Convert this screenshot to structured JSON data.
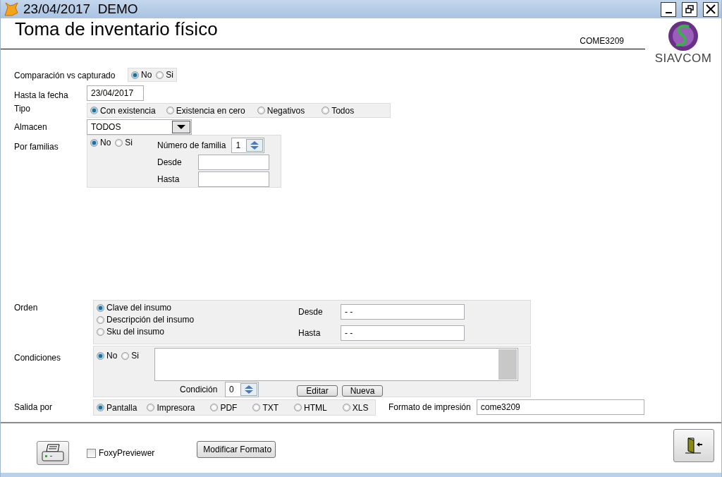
{
  "window": {
    "title": "23/04/2017  DEMO"
  },
  "header": {
    "title": "Toma de inventario físico",
    "code": "COME3209",
    "logo_text": "SIAVCOM"
  },
  "comparacion": {
    "label": "Comparación vs capturado",
    "options": [
      {
        "label": "No",
        "selected": true
      },
      {
        "label": "Si",
        "selected": false
      }
    ]
  },
  "hasta_fecha": {
    "label": "Hasta la fecha",
    "value": "23/04/2017"
  },
  "tipo": {
    "label": "Tipo",
    "options": [
      {
        "label": "Con existencia",
        "selected": true
      },
      {
        "label": "Existencia en cero",
        "selected": false
      },
      {
        "label": "Negativos",
        "selected": false
      },
      {
        "label": "Todos",
        "selected": false
      }
    ]
  },
  "almacen": {
    "label": "Almacen",
    "value": "TODOS"
  },
  "familias": {
    "label": "Por familias",
    "options": [
      {
        "label": "No",
        "selected": true
      },
      {
        "label": "Si",
        "selected": false
      }
    ],
    "numero_label": "Número de familia",
    "numero_value": "1",
    "desde_label": "Desde",
    "hasta_label": "Hasta"
  },
  "orden": {
    "label": "Orden",
    "options": [
      {
        "label": "Clave del insumo",
        "selected": true
      },
      {
        "label": "Descripción del insumo",
        "selected": false
      },
      {
        "label": "Sku del insumo",
        "selected": false
      }
    ],
    "desde_label": "Desde",
    "desde_value": "- -",
    "hasta_label": "Hasta",
    "hasta_value": "- -"
  },
  "condiciones": {
    "label": "Condiciones",
    "options": [
      {
        "label": "No",
        "selected": true
      },
      {
        "label": "Si",
        "selected": false
      }
    ],
    "condicion_label": "Condición",
    "condicion_value": "0",
    "buttons": [
      "Editar",
      "Nueva"
    ]
  },
  "salida": {
    "label": "Salida por",
    "options": [
      {
        "label": "Pantalla",
        "selected": true
      },
      {
        "label": "Impresora",
        "selected": false
      },
      {
        "label": "PDF",
        "selected": false
      },
      {
        "label": "TXT",
        "selected": false
      },
      {
        "label": "HTML",
        "selected": false
      },
      {
        "label": "XLS",
        "selected": false
      }
    ],
    "formato_label": "Formato de impresión",
    "formato_value": "come3209"
  },
  "footer": {
    "foxy": {
      "label": "FoxyPreviewer",
      "checked": false
    },
    "modify_button": "Modificar Formato"
  }
}
